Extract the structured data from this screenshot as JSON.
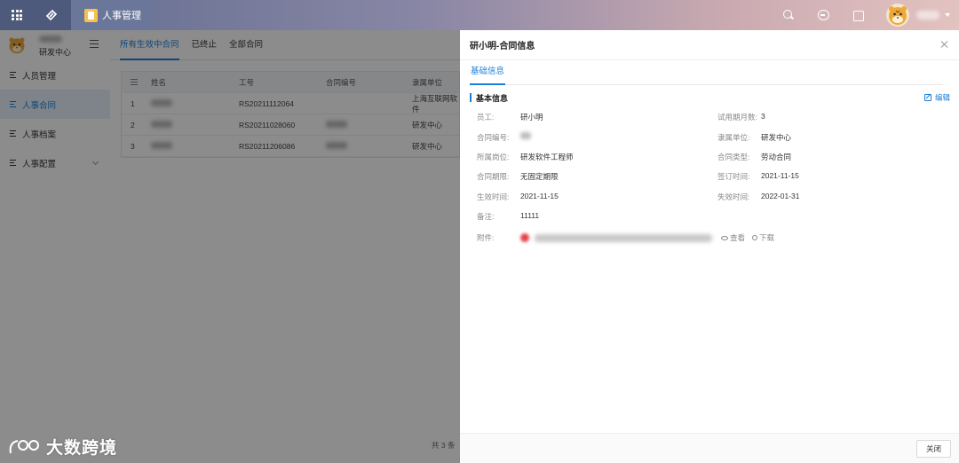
{
  "topbar": {
    "app_title": "人事管理",
    "icons": [
      "apps-grid-icon",
      "logo-icon",
      "search-icon",
      "message-icon",
      "shirt-icon"
    ]
  },
  "sidebar": {
    "dept": "研发中心",
    "items": [
      {
        "label": "人员管理",
        "active": false
      },
      {
        "label": "人事合同",
        "active": true
      },
      {
        "label": "人事档案",
        "active": false
      },
      {
        "label": "人事配置",
        "active": false,
        "expandable": true
      }
    ]
  },
  "watermark": "大数跨境",
  "main": {
    "tabs": [
      {
        "label": "所有生效中合同",
        "active": true
      },
      {
        "label": "已终止",
        "active": false
      },
      {
        "label": "全部合同",
        "active": false
      }
    ],
    "table": {
      "headers": [
        "姓名",
        "工号",
        "合同编号",
        "隶属单位"
      ],
      "rows": [
        {
          "index": "1",
          "emp_no": "RS20211112064",
          "unit": "上海互联网软件"
        },
        {
          "index": "2",
          "emp_no": "RS20211028060",
          "unit": "研发中心"
        },
        {
          "index": "3",
          "emp_no": "RS20211206086",
          "unit": "研发中心"
        }
      ]
    },
    "pager": "共 3 条"
  },
  "drawer": {
    "title": "研小明-合同信息",
    "tab": "基础信息",
    "section_title": "基本信息",
    "edit_label": "编辑",
    "left_fields": [
      {
        "label": "员工:",
        "value": "研小明"
      },
      {
        "label": "合同编号:",
        "value": ""
      },
      {
        "label": "所属岗位:",
        "value": "研发软件工程师"
      },
      {
        "label": "合同期限:",
        "value": "无固定期限"
      },
      {
        "label": "生效时间:",
        "value": "2021-11-15"
      },
      {
        "label": "备注:",
        "value": "11111"
      }
    ],
    "right_fields": [
      {
        "label": "试用期月数:",
        "value": "3"
      },
      {
        "label": "隶属单位:",
        "value": "研发中心"
      },
      {
        "label": "合同类型:",
        "value": "劳动合同"
      },
      {
        "label": "签订时间:",
        "value": "2021-11-15"
      },
      {
        "label": "失效时间:",
        "value": "2022-01-31"
      }
    ],
    "attachment": {
      "label": "附件:",
      "view": "查看",
      "download": "下载"
    },
    "close_button": "关闭"
  }
}
